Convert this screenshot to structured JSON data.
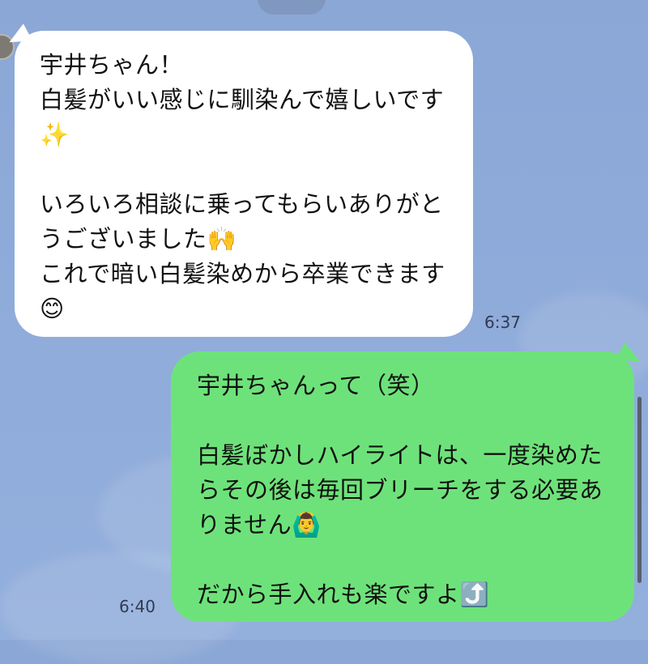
{
  "chat": {
    "incoming": {
      "text": "宇井ちゃん！\n白髪がいい感じに馴染んで嬉しいです✨\n\nいろいろ相談に乗ってもらいありがとうございました🙌\nこれで暗い白髪染めから卒業できます😊",
      "time": "6:37"
    },
    "outgoing": {
      "text": "宇井ちゃんって（笑）\n\n白髪ぼかしハイライトは、一度染めたらその後は毎回ブリーチをする必要ありません🙆‍♂️\n\nだから手入れも楽ですよ⤴️",
      "time": "6:40"
    }
  }
}
